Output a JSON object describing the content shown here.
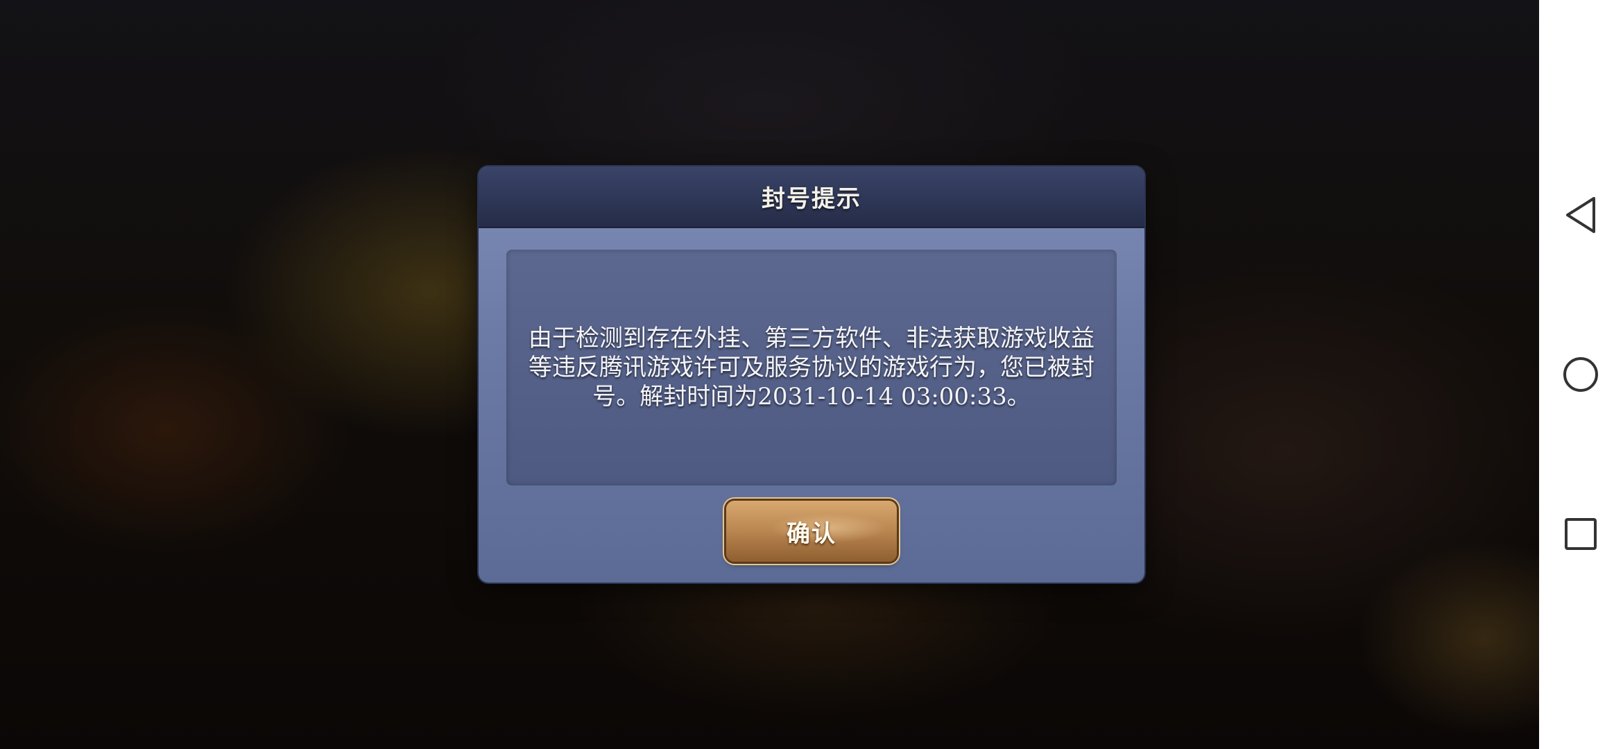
{
  "dialog": {
    "title": "封号提示",
    "message": "由于检测到存在外挂、第三方软件、非法获取游戏收益等违反腾讯游戏许可及服务协议的游戏行为，您已被封号。解封时间为2031-10-14 03:00:33。",
    "confirm_label": "确认"
  },
  "nav_bar": {
    "buttons": [
      {
        "icon": "back-triangle-icon"
      },
      {
        "icon": "home-circle-icon"
      },
      {
        "icon": "recents-square-icon"
      }
    ]
  },
  "colors": {
    "dialog_header": "#252c48",
    "dialog_body": "#6c7ba6",
    "confirm_button": "#b98550",
    "nav_bar": "#ffffff"
  }
}
